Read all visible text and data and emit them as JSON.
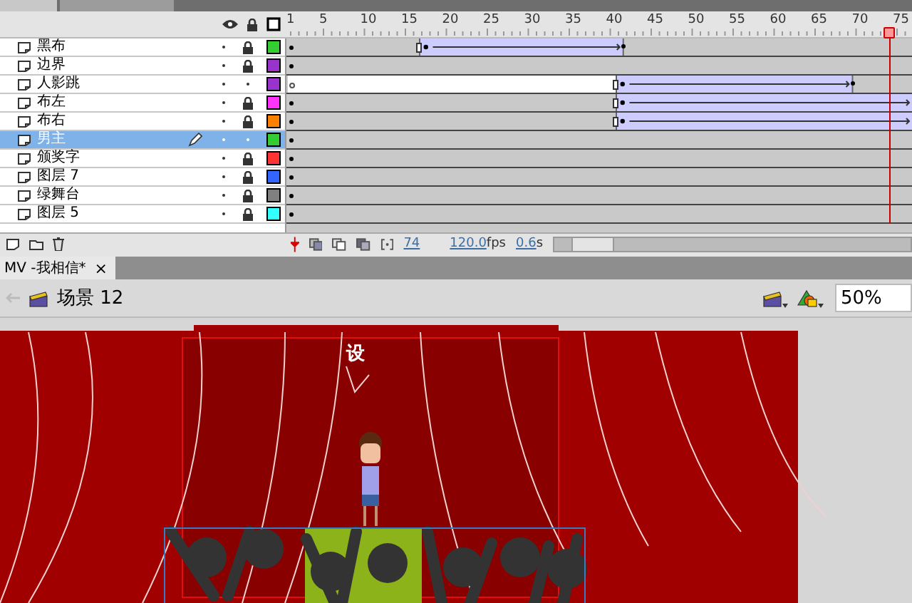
{
  "timeline": {
    "ruler": [
      "1",
      "5",
      "10",
      "15",
      "20",
      "25",
      "30",
      "35",
      "40",
      "45",
      "50",
      "55",
      "60",
      "65",
      "70",
      "75"
    ],
    "layers": [
      {
        "name": "黑布",
        "locked": true,
        "selected": false,
        "kind": "filled",
        "color": "#33cc33",
        "tweens": [
          {
            "from": {
              "level": 0.211
            },
            "to": {
              "level": 0.538
            }
          }
        ]
      },
      {
        "name": "边界",
        "locked": true,
        "selected": false,
        "kind": "filled",
        "color": "#9933cc"
      },
      {
        "name": "人影跳",
        "locked": false,
        "selected": false,
        "kind": "empty",
        "color": "#9933cc",
        "tweens": [
          {
            "from": {
              "level": 0.525
            },
            "to": {
              "level": 0.904
            }
          }
        ]
      },
      {
        "name": "布左",
        "locked": true,
        "selected": false,
        "kind": "filled",
        "color": "#ff33ff",
        "tweens": [
          {
            "from": {
              "level": 0.525
            },
            "to": {
              "level": 1
            }
          }
        ]
      },
      {
        "name": "布右",
        "locked": true,
        "selected": false,
        "kind": "filled",
        "color": "#ff8000",
        "tweens": [
          {
            "from": {
              "level": 0.525
            },
            "to": {
              "level": 1
            }
          }
        ]
      },
      {
        "name": "男主",
        "locked": false,
        "selected": true,
        "kind": "filled",
        "color": "#33cc33"
      },
      {
        "name": "颁奖字",
        "locked": true,
        "selected": false,
        "kind": "filled",
        "color": "#ff3333"
      },
      {
        "name": "图层 7",
        "locked": true,
        "selected": false,
        "kind": "filled",
        "color": "#3366ff"
      },
      {
        "name": "绿舞台",
        "locked": true,
        "selected": false,
        "kind": "filled",
        "color": "#808080"
      },
      {
        "name": "图层 5",
        "locked": true,
        "selected": false,
        "kind": "filled",
        "color": "#33ffff"
      }
    ],
    "current_frame": "74",
    "frame_rate": "120.0",
    "frame_rate_unit": "fps",
    "elapsed": "0.6",
    "elapsed_unit": "s"
  },
  "document_tab": {
    "title": "MV -我相信*",
    "close": "×"
  },
  "scene_bar": {
    "scene": "场景 12",
    "zoom": "50%"
  },
  "stage": {
    "title_text": "设"
  }
}
